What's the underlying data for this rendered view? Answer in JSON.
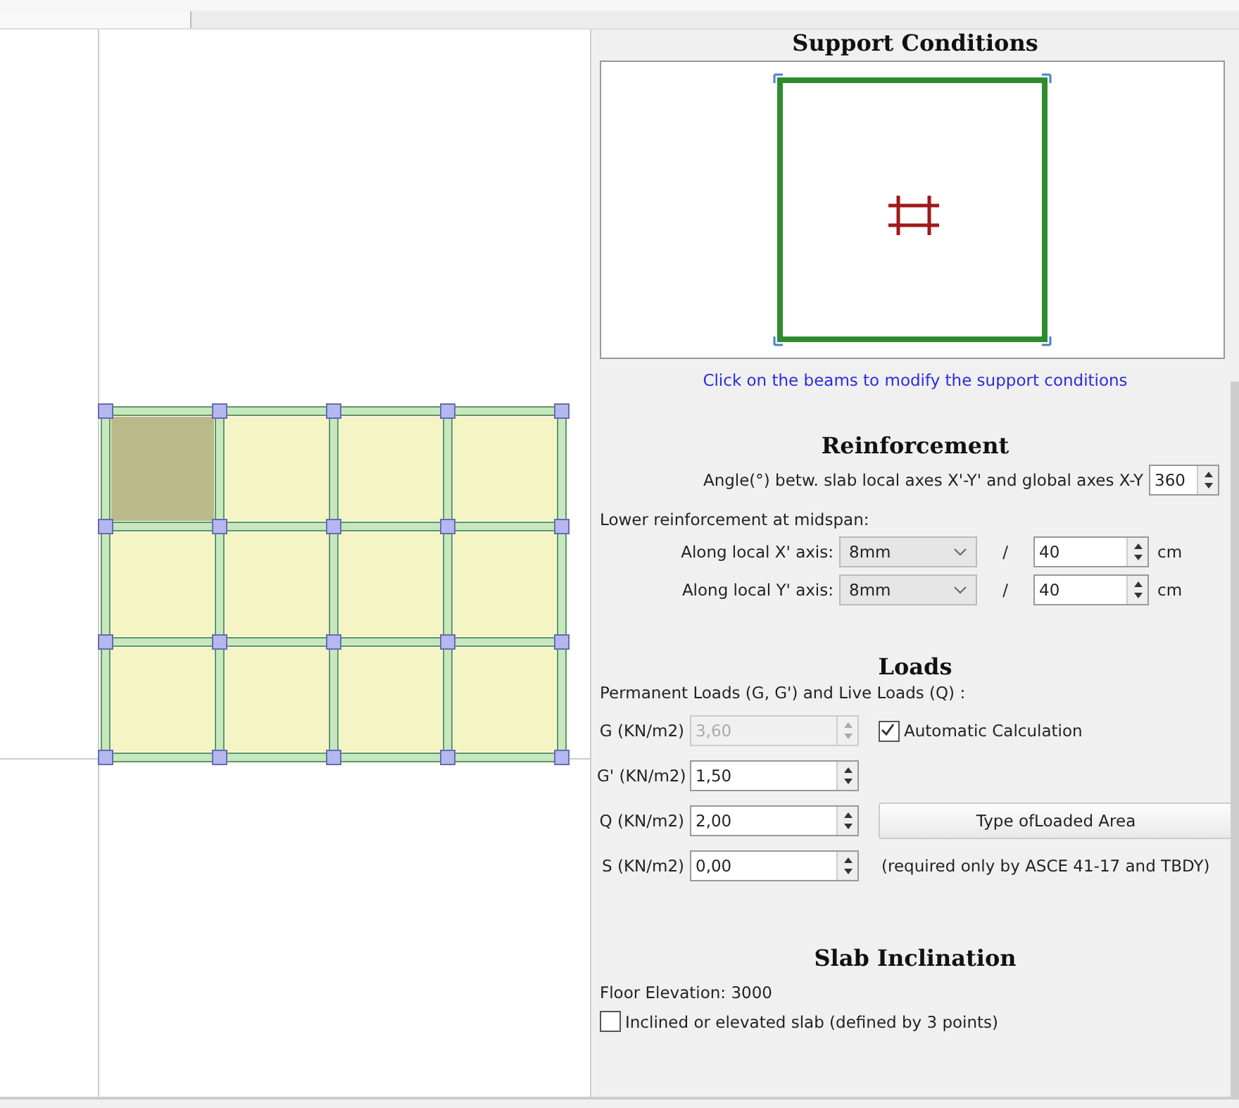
{
  "support_conditions": {
    "title": "Support Conditions",
    "hint": "Click on the beams to modify the support conditions"
  },
  "floor_plan": {
    "slabs": [
      {
        "selected": true
      },
      {
        "selected": false
      },
      {
        "selected": false
      },
      {
        "selected": false
      },
      {
        "selected": false
      },
      {
        "selected": false
      },
      {
        "selected": false
      },
      {
        "selected": false
      },
      {
        "selected": false
      },
      {
        "selected": false
      },
      {
        "selected": false
      },
      {
        "selected": false
      }
    ]
  },
  "reinforcement": {
    "title": "Reinforcement",
    "angle_label": "Angle(°) betw. slab local axes X'-Y' and global axes X-Y",
    "angle_value": "360",
    "lower_label": "Lower reinforcement at midspan:",
    "rows": [
      {
        "label": "Along local X' axis:",
        "bar": "8mm",
        "separator": "/",
        "spacing": "40",
        "unit": "cm"
      },
      {
        "label": "Along local Y' axis:",
        "bar": "8mm",
        "separator": "/",
        "spacing": "40",
        "unit": "cm"
      }
    ]
  },
  "loads": {
    "title": "Loads",
    "subtitle": "Permanent Loads (G, G') and Live Loads (Q) :",
    "fields": [
      {
        "label": "G (KN/m2)",
        "value": "3,60",
        "disabled": true
      },
      {
        "label": "G' (KN/m2)",
        "value": "1,50",
        "disabled": false
      },
      {
        "label": "Q (KN/m2)",
        "value": "2,00",
        "disabled": false
      },
      {
        "label": "S (KN/m2)",
        "value": "0,00",
        "disabled": false
      }
    ],
    "auto_calc": {
      "label": "Automatic Calculation",
      "checked": true
    },
    "button": "Type ofLoaded Area",
    "note": "(required only by ASCE 41-17 and TBDY)"
  },
  "slab_inclination": {
    "title": "Slab Inclination",
    "elevation": "Floor Elevation: 3000",
    "inclined": {
      "label": "Inclined or elevated slab (defined by 3 points)",
      "checked": false
    }
  }
}
